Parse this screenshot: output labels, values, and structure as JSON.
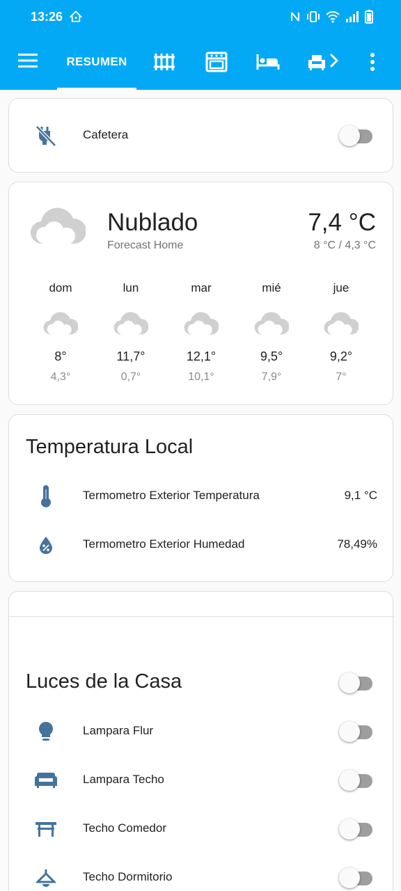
{
  "status_bar": {
    "time": "13:26"
  },
  "toolbar": {
    "tabs": [
      {
        "label": "RESUMEN",
        "icon": "dashboard-tab",
        "selected": true
      },
      {
        "label": "",
        "icon": "radiator-icon"
      },
      {
        "label": "",
        "icon": "stove-icon"
      },
      {
        "label": "",
        "icon": "bed-icon"
      },
      {
        "label": "",
        "icon": "sofa-icon"
      }
    ]
  },
  "cafetera_card": {
    "label": "Cafetera",
    "icon": "power-plug-off-icon",
    "toggle_on": false
  },
  "weather_card": {
    "condition": "Nublado",
    "location": "Forecast Home",
    "temperature": "7,4 °C",
    "range": "8 °C / 4,3 °C",
    "forecast": [
      {
        "day": "dom",
        "high": "8°",
        "low": "4,3°",
        "icon": "cloudy-icon"
      },
      {
        "day": "lun",
        "high": "11,7°",
        "low": "0,7°",
        "icon": "cloudy-icon"
      },
      {
        "day": "mar",
        "high": "12,1°",
        "low": "10,1°",
        "icon": "cloudy-icon"
      },
      {
        "day": "mié",
        "high": "9,5°",
        "low": "7,9°",
        "icon": "cloudy-icon"
      },
      {
        "day": "jue",
        "high": "9,2°",
        "low": "7°",
        "icon": "cloudy-icon"
      }
    ]
  },
  "temperature_card": {
    "title": "Temperatura Local",
    "rows": [
      {
        "label": "Termometro Exterior Temperatura",
        "value": "9,1 °C",
        "icon": "thermometer-icon"
      },
      {
        "label": "Termometro Exterior Humedad",
        "value": "78,49%",
        "icon": "water-percent-icon"
      }
    ]
  },
  "lights_card": {
    "title": "Luces de la Casa",
    "master_toggle_on": false,
    "rows": [
      {
        "label": "Lampara Flur",
        "icon": "lightbulb-icon",
        "toggle_on": false
      },
      {
        "label": "Lampara Techo",
        "icon": "sofa-icon",
        "toggle_on": false
      },
      {
        "label": "Techo Comedor",
        "icon": "table-furniture-icon",
        "toggle_on": false
      },
      {
        "label": "Techo Dormitorio",
        "icon": "ceiling-light-icon",
        "toggle_on": false
      }
    ]
  },
  "colors": {
    "primary": "#03a9f4",
    "icon": "#44739e",
    "weather_icon": "#d0d0d0"
  }
}
